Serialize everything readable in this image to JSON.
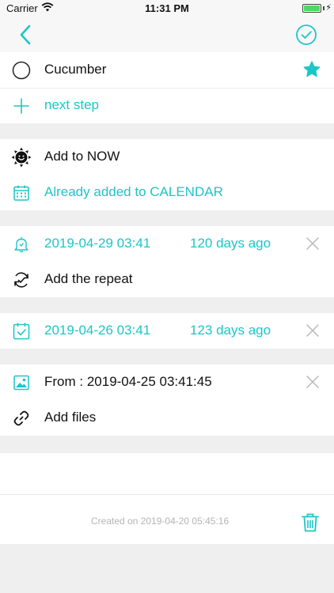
{
  "status_bar": {
    "carrier": "Carrier",
    "time": "11:31 PM"
  },
  "navbar": {
    "back_icon": "chevron-left-icon",
    "done_icon": "check-circle-icon"
  },
  "task": {
    "title": "Cucumber",
    "next_step": "next step",
    "starred": true
  },
  "actions": {
    "add_to_now": "Add to NOW",
    "calendar": "Already added to CALENDAR"
  },
  "reminder": {
    "date": "2019-04-29 03:41",
    "relative": "120 days ago",
    "repeat": "Add the repeat"
  },
  "due": {
    "date": "2019-04-26 03:41",
    "relative": "123 days ago"
  },
  "attachments": {
    "from": "From : 2019-04-25 03:41:45",
    "add_files": "Add files"
  },
  "footer": {
    "created": "Created on 2019-04-20 05:45:16"
  },
  "colors": {
    "accent": "#1cc6c8",
    "separator_bg": "#efefef"
  }
}
